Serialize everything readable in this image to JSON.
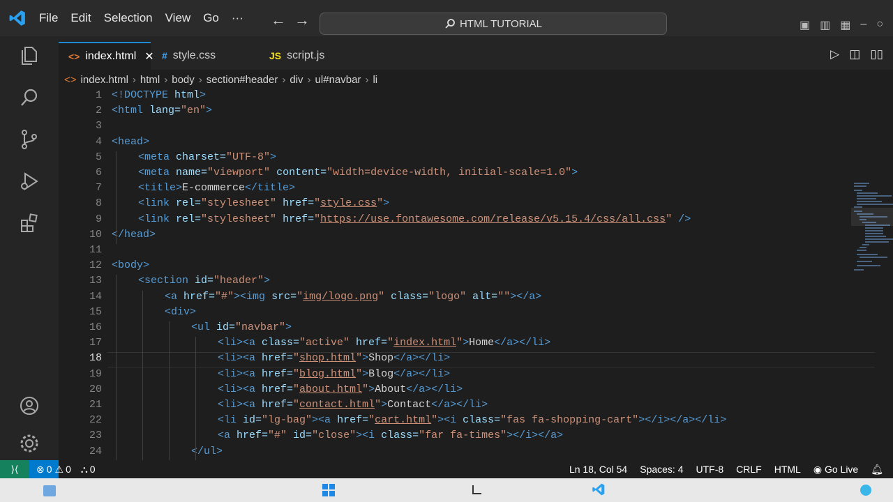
{
  "menu": [
    "File",
    "Edit",
    "Selection",
    "View",
    "Go",
    "···"
  ],
  "search_label": "HTML TUTORIAL",
  "tabs": [
    {
      "label": "index.html",
      "icon": "<>",
      "active": true
    },
    {
      "label": "style.css",
      "icon": "#",
      "active": false
    },
    {
      "label": "script.js",
      "icon": "JS",
      "active": false
    }
  ],
  "breadcrumb": [
    "index.html",
    "html",
    "body",
    "section#header",
    "div",
    "ul#navbar",
    "li"
  ],
  "code_lines": [
    {
      "n": "1",
      "indent": 0,
      "parts": [
        [
          "tg",
          "<!DOCTYPE "
        ],
        [
          "at",
          "html"
        ],
        [
          "tg",
          ">"
        ]
      ]
    },
    {
      "n": "2",
      "indent": 0,
      "parts": [
        [
          "tg",
          "<html "
        ],
        [
          "at",
          "lang="
        ],
        [
          "st",
          "\"en\""
        ],
        [
          "tg",
          ">"
        ]
      ]
    },
    {
      "n": "3",
      "indent": 0,
      "parts": []
    },
    {
      "n": "4",
      "indent": 0,
      "parts": [
        [
          "tg",
          "<head>"
        ]
      ]
    },
    {
      "n": "5",
      "indent": 1,
      "parts": [
        [
          "tg",
          "<meta "
        ],
        [
          "at",
          "charset="
        ],
        [
          "st",
          "\"UTF-8\""
        ],
        [
          "tg",
          ">"
        ]
      ]
    },
    {
      "n": "6",
      "indent": 1,
      "parts": [
        [
          "tg",
          "<meta "
        ],
        [
          "at",
          "name="
        ],
        [
          "st",
          "\"viewport\" "
        ],
        [
          "at",
          "content="
        ],
        [
          "st",
          "\"width=device-width, initial-scale=1.0\""
        ],
        [
          "tg",
          ">"
        ]
      ]
    },
    {
      "n": "7",
      "indent": 1,
      "parts": [
        [
          "tg",
          "<title>"
        ],
        [
          "tx",
          "E-commerce"
        ],
        [
          "tg",
          "</title>"
        ]
      ]
    },
    {
      "n": "8",
      "indent": 1,
      "parts": [
        [
          "tg",
          "<link "
        ],
        [
          "at",
          "rel="
        ],
        [
          "st",
          "\"stylesheet\" "
        ],
        [
          "at",
          "href="
        ],
        [
          "st",
          "\""
        ],
        [
          "lk",
          "style.css"
        ],
        [
          "st",
          "\""
        ],
        [
          "tg",
          ">"
        ]
      ]
    },
    {
      "n": "9",
      "indent": 1,
      "parts": [
        [
          "tg",
          "<link "
        ],
        [
          "at",
          "rel="
        ],
        [
          "st",
          "\"stylesheet\" "
        ],
        [
          "at",
          "href="
        ],
        [
          "st",
          "\""
        ],
        [
          "lk",
          "https://use.fontawesome.com/release/v5.15.4/css/all.css"
        ],
        [
          "st",
          "\" "
        ],
        [
          "tg",
          "/>"
        ]
      ]
    },
    {
      "n": "10",
      "indent": 0,
      "parts": [
        [
          "tg",
          "</head>"
        ]
      ]
    },
    {
      "n": "11",
      "indent": 0,
      "parts": []
    },
    {
      "n": "12",
      "indent": 0,
      "parts": [
        [
          "tg",
          "<body>"
        ]
      ]
    },
    {
      "n": "13",
      "indent": 1,
      "parts": [
        [
          "tg",
          "<section "
        ],
        [
          "at",
          "id="
        ],
        [
          "st",
          "\"header\""
        ],
        [
          "tg",
          ">"
        ]
      ]
    },
    {
      "n": "14",
      "indent": 2,
      "parts": [
        [
          "tg",
          "<a "
        ],
        [
          "at",
          "href="
        ],
        [
          "st",
          "\"#\""
        ],
        [
          "tg",
          "><img "
        ],
        [
          "at",
          "src="
        ],
        [
          "st",
          "\""
        ],
        [
          "lk",
          "img/logo.png"
        ],
        [
          "st",
          "\" "
        ],
        [
          "at",
          "class="
        ],
        [
          "st",
          "\"logo\" "
        ],
        [
          "at",
          "alt="
        ],
        [
          "st",
          "\"\""
        ],
        [
          "tg",
          "></a>"
        ]
      ]
    },
    {
      "n": "15",
      "indent": 2,
      "parts": [
        [
          "tg",
          "<div>"
        ]
      ]
    },
    {
      "n": "16",
      "indent": 3,
      "parts": [
        [
          "tg",
          "<ul "
        ],
        [
          "at",
          "id="
        ],
        [
          "st",
          "\"navbar\""
        ],
        [
          "tg",
          ">"
        ]
      ]
    },
    {
      "n": "17",
      "indent": 4,
      "parts": [
        [
          "tg",
          "<li><a "
        ],
        [
          "at",
          "class="
        ],
        [
          "st",
          "\"active\" "
        ],
        [
          "at",
          "href="
        ],
        [
          "st",
          "\""
        ],
        [
          "lk",
          "index.html"
        ],
        [
          "st",
          "\""
        ],
        [
          "tg",
          ">"
        ],
        [
          "tx",
          "Home"
        ],
        [
          "tg",
          "</a></li>"
        ]
      ]
    },
    {
      "n": "18",
      "indent": 4,
      "parts": [
        [
          "tg",
          "<li><a "
        ],
        [
          "at",
          "href="
        ],
        [
          "st",
          "\""
        ],
        [
          "lk",
          "shop.html"
        ],
        [
          "st",
          "\""
        ],
        [
          "tg",
          ">"
        ],
        [
          "tx",
          "Shop"
        ],
        [
          "tg",
          "</a></li>"
        ]
      ]
    },
    {
      "n": "19",
      "indent": 4,
      "parts": [
        [
          "tg",
          "<li><a "
        ],
        [
          "at",
          "href="
        ],
        [
          "st",
          "\""
        ],
        [
          "lk",
          "blog.html"
        ],
        [
          "st",
          "\""
        ],
        [
          "tg",
          ">"
        ],
        [
          "tx",
          "Blog"
        ],
        [
          "tg",
          "</a></li>"
        ]
      ]
    },
    {
      "n": "20",
      "indent": 4,
      "parts": [
        [
          "tg",
          "<li><a "
        ],
        [
          "at",
          "href="
        ],
        [
          "st",
          "\""
        ],
        [
          "lk",
          "about.html"
        ],
        [
          "st",
          "\""
        ],
        [
          "tg",
          ">"
        ],
        [
          "tx",
          "About"
        ],
        [
          "tg",
          "</a></li>"
        ]
      ]
    },
    {
      "n": "21",
      "indent": 4,
      "parts": [
        [
          "tg",
          "<li><a "
        ],
        [
          "at",
          "href="
        ],
        [
          "st",
          "\""
        ],
        [
          "lk",
          "contact.html"
        ],
        [
          "st",
          "\""
        ],
        [
          "tg",
          ">"
        ],
        [
          "tx",
          "Contact"
        ],
        [
          "tg",
          "</a></li>"
        ]
      ]
    },
    {
      "n": "22",
      "indent": 4,
      "parts": [
        [
          "tg",
          "<li "
        ],
        [
          "at",
          "id="
        ],
        [
          "st",
          "\"lg-bag\""
        ],
        [
          "tg",
          "><a "
        ],
        [
          "at",
          "href="
        ],
        [
          "st",
          "\""
        ],
        [
          "lk",
          "cart.html"
        ],
        [
          "st",
          "\""
        ],
        [
          "tg",
          "><i "
        ],
        [
          "at",
          "class="
        ],
        [
          "st",
          "\"fas fa-shopping-cart\""
        ],
        [
          "tg",
          "></i></a></li>"
        ]
      ]
    },
    {
      "n": "23",
      "indent": 4,
      "parts": [
        [
          "tg",
          "<a "
        ],
        [
          "at",
          "href="
        ],
        [
          "st",
          "\"#\" "
        ],
        [
          "at",
          "id="
        ],
        [
          "st",
          "\"close\""
        ],
        [
          "tg",
          "><i "
        ],
        [
          "at",
          "class="
        ],
        [
          "st",
          "\"far fa-times\""
        ],
        [
          "tg",
          "></i></a>"
        ]
      ]
    },
    {
      "n": "24",
      "indent": 3,
      "parts": [
        [
          "tg",
          "</ul>"
        ]
      ]
    }
  ],
  "current_line": "18",
  "status": {
    "errors": "0",
    "warnings": "0",
    "ports": "0",
    "position": "Ln 18, Col 54",
    "spaces": "Spaces: 4",
    "encoding": "UTF-8",
    "eol": "CRLF",
    "language": "HTML",
    "golive": "Go Live"
  },
  "colors": {
    "accent": "#007acc",
    "tag": "#569cd6",
    "attr": "#9cdcfe",
    "string": "#ce9178"
  }
}
